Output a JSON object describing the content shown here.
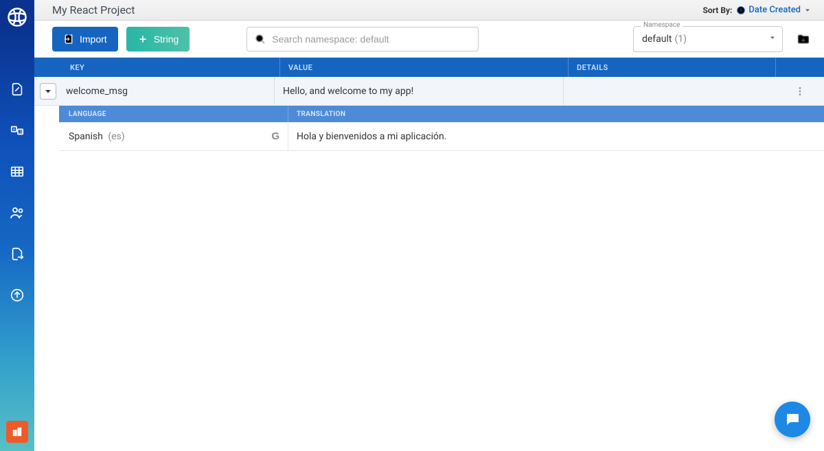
{
  "header": {
    "title": "My React Project",
    "sort_by_label": "Sort By:",
    "sort_by_value": "Date Created"
  },
  "toolbar": {
    "import_label": "Import",
    "string_label": "String",
    "search_placeholder": "Search namespace: default",
    "namespace_legend": "Namespace",
    "namespace_value": "default",
    "namespace_count": "(1)"
  },
  "columns": {
    "key": "KEY",
    "value": "VALUE",
    "details": "DETAILS"
  },
  "row": {
    "key": "welcome_msg",
    "value": "Hello, and welcome to my app!"
  },
  "subcolumns": {
    "language": "LANGUAGE",
    "translation": "TRANSLATION"
  },
  "translation": {
    "language_name": "Spanish",
    "language_code": "(es)",
    "provider_glyph": "G",
    "text": "Hola y bienvenidos a mi aplicación."
  }
}
